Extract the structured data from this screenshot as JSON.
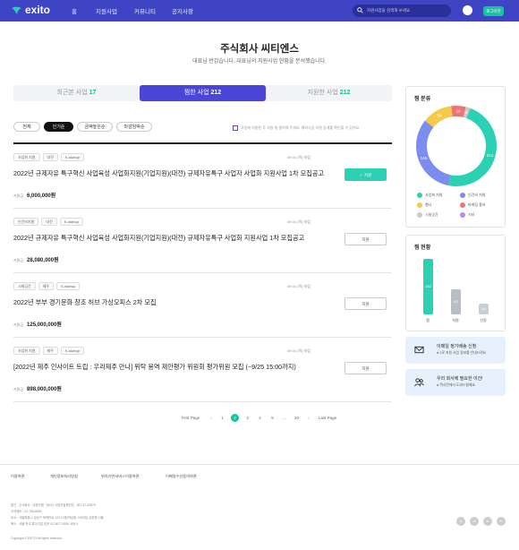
{
  "header": {
    "logo": "exito",
    "nav": [
      "홈",
      "지원사업",
      "커뮤니티",
      "공지사항"
    ],
    "search_placeholder": "지원사업을 검색해 보세요.",
    "login": "로그아웃"
  },
  "page": {
    "title": "주식회사 씨티엔스",
    "subtitle": "대표님 반갑습니다. 대표님의 지원사업 현황을 분석했습니다."
  },
  "tabs": [
    {
      "label": "최근본 사업",
      "count": "17"
    },
    {
      "label": "찜한 사업",
      "count": "212"
    },
    {
      "label": "지원한 사업",
      "count": "212"
    }
  ],
  "filters": [
    "전체",
    "인기순",
    "금액높은순",
    "마감임박순"
  ],
  "note": "사업에 지원한 후 지원 형 클릭해 주세요. 예비사업 지원 등계를 확인할 수 있어요.",
  "programs": [
    {
      "tags": [
        "사업화 지원",
        "대전",
        "K-startup"
      ],
      "date": "09.01 (목) 마감",
      "title": "2022년 규제자유 특구혁신 사업육성 사업화지원(기업지원)(대전) 규제자유특구 사업자 사업화 지원사업 1차 모집공고",
      "amount_label": "지원금",
      "amount": "6,000,000원",
      "button": "✓ 지원",
      "applied": true
    },
    {
      "tags": [
        "인건비지원",
        "대전",
        "K-startup"
      ],
      "date": "09.01 (목) 마감",
      "title": "2022년 규제자유 특구혁신 사업육성 사업화지원(기업지원)(대전) 규제자유특구 사업화 지원사업 1차 모집공고",
      "amount_label": "지원금",
      "amount": "28,080,000원",
      "button": "지원",
      "applied": false
    },
    {
      "tags": [
        "시제공간",
        "제주",
        "K-startup"
      ],
      "date": "09.01 (목) 마감",
      "title": "2022년 부부 경기문화 창조 허브 가상오피스 2차 모집",
      "amount_label": "지원금",
      "amount": "125,000,000원",
      "button": "지원",
      "applied": false
    },
    {
      "tags": [
        "사업화 지원",
        "제주",
        "K-startup"
      ],
      "date": "09.01 (목) 마감",
      "title": "[2022년 제주 인사이트 트립 : 우리제주 만나] 위탁 용역 제안평가 위원회 평가위원 모집 (~9/25 15:00까지)",
      "amount_label": "지원금",
      "amount": "898,000,000원",
      "button": "지원",
      "applied": false
    }
  ],
  "pagination": {
    "first": "First Page",
    "prev": "‹",
    "pages": [
      "1",
      "2",
      "3",
      "4",
      "5",
      "…",
      "20"
    ],
    "current": "2",
    "next": "›",
    "last": "Last Page"
  },
  "category_panel": {
    "title": "찜 분류",
    "center": "212",
    "slices": [
      {
        "label": "사업화 지원",
        "value": 212,
        "color": "#2cd1b4"
      },
      {
        "label": "인건비 지원",
        "value": 146,
        "color": "#7c8df0"
      },
      {
        "label": "행사",
        "value": 54,
        "color": "#f7c948"
      },
      {
        "label": "마케팅 홍보",
        "value": 26,
        "color": "#f07272"
      },
      {
        "label": "시설공간",
        "value": 8,
        "color": "#c9c9c9"
      },
      {
        "label": "기타",
        "value": 0,
        "color": "#b48cf0"
      }
    ]
  },
  "status_panel": {
    "title": "찜 현황",
    "bars": [
      {
        "label": "찜",
        "value": 182,
        "color": "#2cd1b4"
      },
      {
        "label": "지원",
        "value": 83,
        "color": "#b9bec6"
      },
      {
        "label": "선정",
        "value": 16,
        "color": "#c9ced5"
      }
    ]
  },
  "banners": [
    {
      "title": "이메일 정기배송 신청",
      "sub": "● 1로 지원 사업 정보를 안내드려요"
    },
    {
      "title": "우리 회사에 필요한 이건!",
      "sub": "● 맥사전에서 도와드릴께요."
    }
  ],
  "footer": {
    "links": [
      "이용약관",
      "개인정보처리방침",
      "위치기반서비스이용약관",
      "이메일수신동의약관"
    ],
    "lines": [
      "법인 : 주식회사 . 대표자명 : 정OO 사업자등록번호 : 397-87-00879",
      "고객센터 : 02-758-8282",
      "주소 : 서울특별시 강남구 테헤란로 123 12층(역삼동, 00타워) 유한형 서울",
      "팩스 : 서울 판교 특이기업 본관 02-3677-9290 서비스",
      "Copyright © EXITO All rights reserved."
    ],
    "social": [
      "yt",
      "bl",
      "in",
      "fb"
    ]
  }
}
